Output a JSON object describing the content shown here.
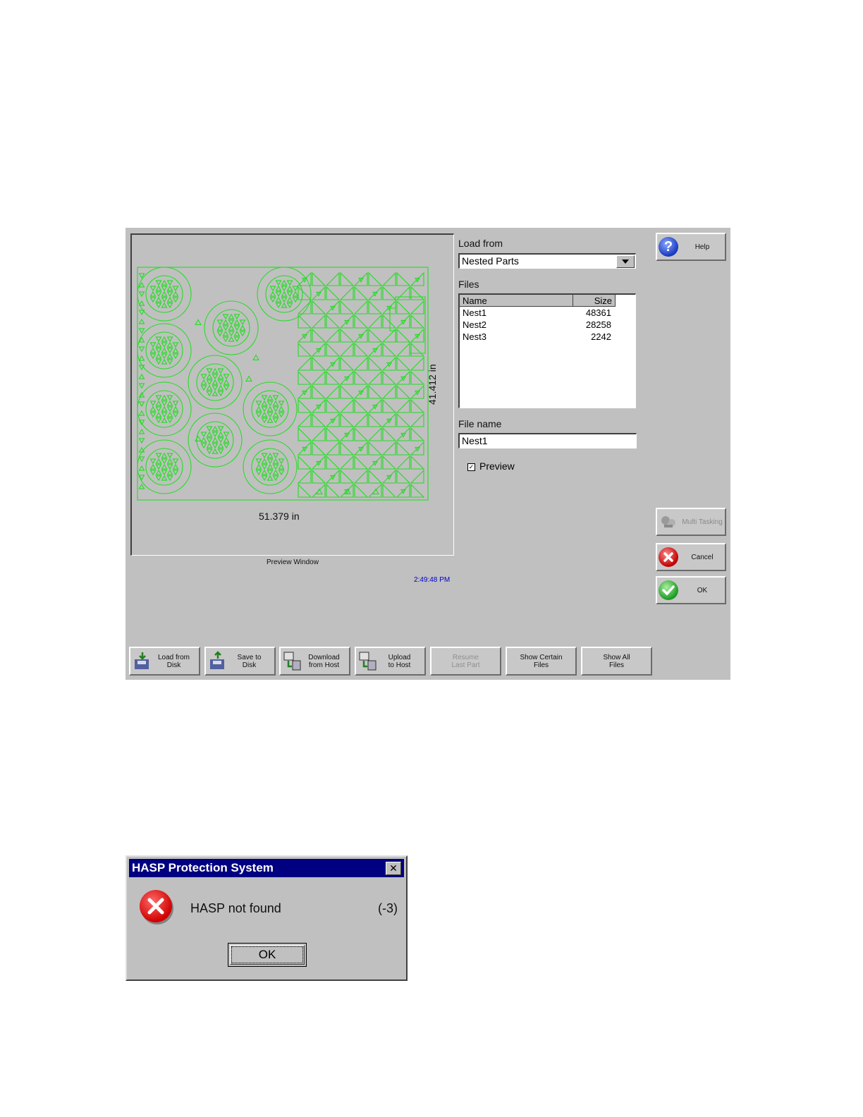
{
  "preview": {
    "width_label": "51.379 in",
    "height_label": "41.412 in",
    "caption": "Preview Window",
    "clock": "2:49:48 PM",
    "part_color": "#22dd22"
  },
  "load_from": {
    "label": "Load from",
    "selected": "Nested Parts"
  },
  "files": {
    "label": "Files",
    "columns": [
      "Name",
      "Size"
    ],
    "rows": [
      {
        "name": "Nest1",
        "size": "48361"
      },
      {
        "name": "Nest2",
        "size": "28258"
      },
      {
        "name": "Nest3",
        "size": "2242"
      }
    ]
  },
  "file_name": {
    "label": "File name",
    "value": "Nest1"
  },
  "preview_checkbox": {
    "label": "Preview",
    "checked": true
  },
  "side_buttons": {
    "help": "Help",
    "multi_tasking": "Multi Tasking",
    "cancel": "Cancel",
    "ok": "OK"
  },
  "toolbar": [
    {
      "line1": "Load from",
      "line2": "Disk",
      "icon": "disk-load-icon"
    },
    {
      "line1": "Save to",
      "line2": "Disk",
      "icon": "disk-save-icon"
    },
    {
      "line1": "Download",
      "line2": "from Host",
      "icon": "host-download-icon"
    },
    {
      "line1": "Upload",
      "line2": "to Host",
      "icon": "host-upload-icon"
    },
    {
      "line1": "Resume",
      "line2": "Last Part",
      "icon": ""
    },
    {
      "line1": "Show Certain",
      "line2": "Files",
      "icon": ""
    },
    {
      "line1": "Show All",
      "line2": "Files",
      "icon": ""
    }
  ],
  "dialog": {
    "title": "HASP Protection System",
    "close_glyph": "✕",
    "message": "HASP not found",
    "code": "(-3)",
    "ok": "OK"
  }
}
